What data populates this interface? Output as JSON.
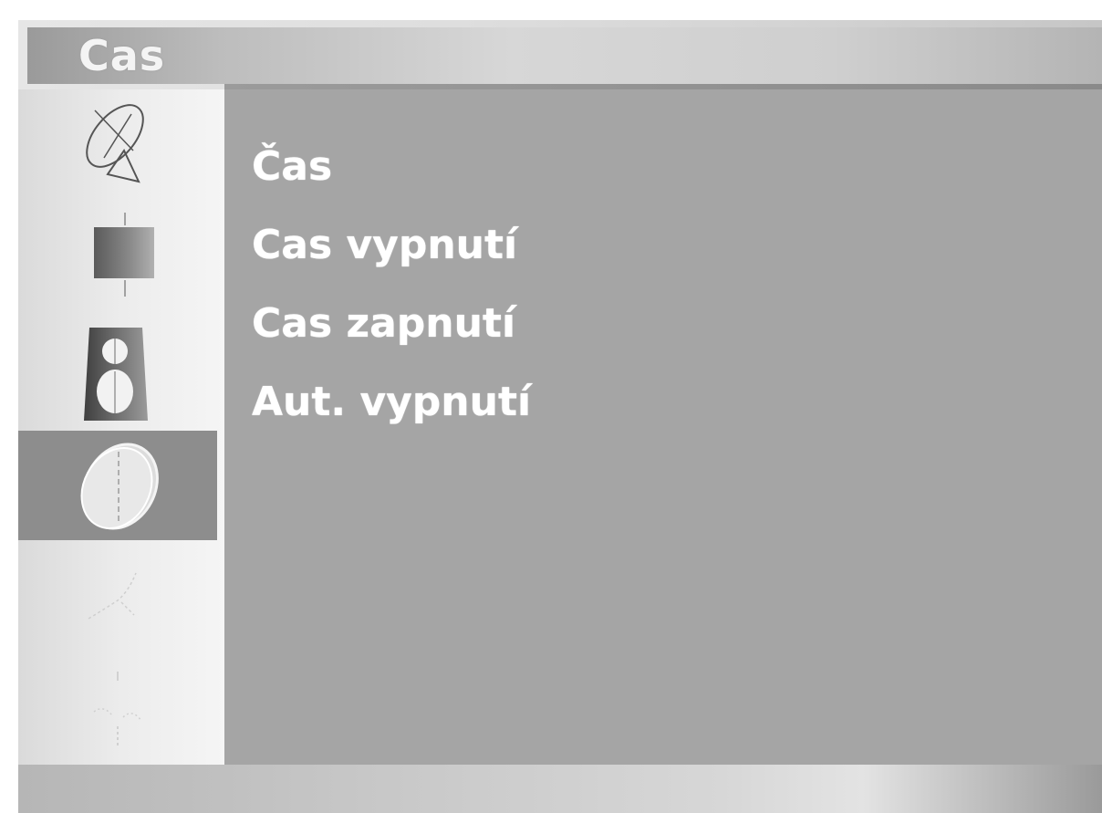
{
  "header": {
    "title": "Cas"
  },
  "sidebar": {
    "items": [
      {
        "icon": "satellite-dish-icon",
        "selected": false
      },
      {
        "icon": "picture-icon",
        "selected": false
      },
      {
        "icon": "speaker-icon",
        "selected": false
      },
      {
        "icon": "clock-icon",
        "selected": true
      },
      {
        "icon": "tools-icon",
        "selected": false
      },
      {
        "icon": "setup-icon",
        "selected": false
      }
    ]
  },
  "menu": {
    "items": [
      {
        "label": "Čas"
      },
      {
        "label": "Cas vypnutí"
      },
      {
        "label": "Cas zapnutí"
      },
      {
        "label": "Aut. vypnutí"
      }
    ]
  },
  "colors": {
    "content_background": "#a5a5a5",
    "selected_item": "#8d8d8d",
    "menu_text": "#ffffff"
  }
}
